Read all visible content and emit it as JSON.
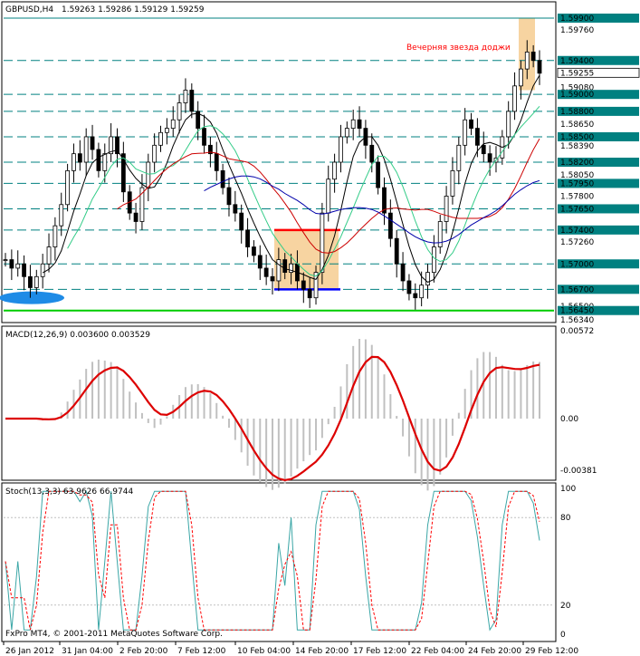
{
  "header": {
    "symbol": "GBPUSD,H4",
    "ohlc": "1.59263 1.59286 1.59129 1.59259"
  },
  "annotation": "Вечерняя звезда доджи",
  "copyright": "FxPro MT4, © 2001-2011 MetaQuotes Software Corp.",
  "colors": {
    "grid_dashed": "#008080",
    "resistance": "#008080",
    "support_green": "#00cc00",
    "highlight_box": "#f5c98a",
    "box_top": "#ff0000",
    "box_bottom": "#0000ff",
    "ma_black": "#000000",
    "ma_green": "#33cc88",
    "ma_red": "#cc0000",
    "ma_blue": "#0000aa",
    "ellipse": "#1e8be6",
    "macd_line": "#dd0000",
    "macd_hist": "#c0c0c0",
    "stoch_main": "#3aa6a6",
    "stoch_signal": "#ff0000",
    "annotation_text": "#ff0000"
  },
  "chart_data": {
    "type": "candlestick",
    "price_labels": [
      "1.59900",
      "1.59760",
      "1.59400",
      "1.59255",
      "1.59080",
      "1.59000",
      "1.58800",
      "1.58650",
      "1.58500",
      "1.58390",
      "1.58200",
      "1.58050",
      "1.57950",
      "1.57800",
      "1.57650",
      "1.57400",
      "1.57260",
      "1.57000",
      "1.56700",
      "1.56500",
      "1.56450",
      "1.56340"
    ],
    "highlighted_price_labels": [
      "1.59900",
      "1.59400",
      "1.59255",
      "1.59000",
      "1.58800",
      "1.58500",
      "1.58200",
      "1.57950",
      "1.57650",
      "1.57400",
      "1.57000",
      "1.56700",
      "1.56450"
    ],
    "time_labels": [
      "26 Jan 2012",
      "31 Jan 04:00",
      "2 Feb 20:00",
      "7 Feb 12:00",
      "10 Feb 04:00",
      "14 Feb 20:00",
      "17 Feb 12:00",
      "22 Feb 04:00",
      "24 Feb 20:00",
      "29 Feb 12:00"
    ],
    "close_path": [
      1.5705,
      1.5695,
      1.57,
      1.5685,
      1.5672,
      1.5685,
      1.57,
      1.572,
      1.5745,
      1.577,
      1.581,
      1.583,
      1.582,
      1.585,
      1.5835,
      1.581,
      1.583,
      1.585,
      1.583,
      1.5785,
      1.576,
      1.575,
      1.579,
      1.582,
      1.584,
      1.5855,
      1.586,
      1.587,
      1.589,
      1.5905,
      1.588,
      1.586,
      1.584,
      1.583,
      1.581,
      1.579,
      1.577,
      1.576,
      1.574,
      1.572,
      1.571,
      1.5695,
      1.5685,
      1.568,
      1.5705,
      1.569,
      1.57,
      1.568,
      1.567,
      1.566,
      1.569,
      1.576,
      1.58,
      1.582,
      1.585,
      1.586,
      1.587,
      1.586,
      1.584,
      1.582,
      1.579,
      1.576,
      1.573,
      1.57,
      1.568,
      1.5665,
      1.566,
      1.5675,
      1.569,
      1.572,
      1.575,
      1.578,
      1.581,
      1.584,
      1.587,
      1.586,
      1.584,
      1.583,
      1.582,
      1.5825,
      1.585,
      1.588,
      1.591,
      1.593,
      1.595,
      1.594,
      1.5925
    ],
    "resistance_levels": [
      1.599,
      1.594,
      1.59,
      1.588,
      1.585,
      1.582,
      1.5795,
      1.5765,
      1.574,
      1.57,
      1.567,
      1.5645
    ],
    "macd": {
      "name": "MACD(12,26,9) 0.003600 0.003529",
      "ticks": [
        "0.00572",
        "0.00",
        "-0.00381"
      ]
    },
    "stoch": {
      "name": "Stoch(13,3,3) 63.9626 66.9744",
      "ticks": [
        "100",
        "80",
        "20",
        "0"
      ]
    }
  }
}
